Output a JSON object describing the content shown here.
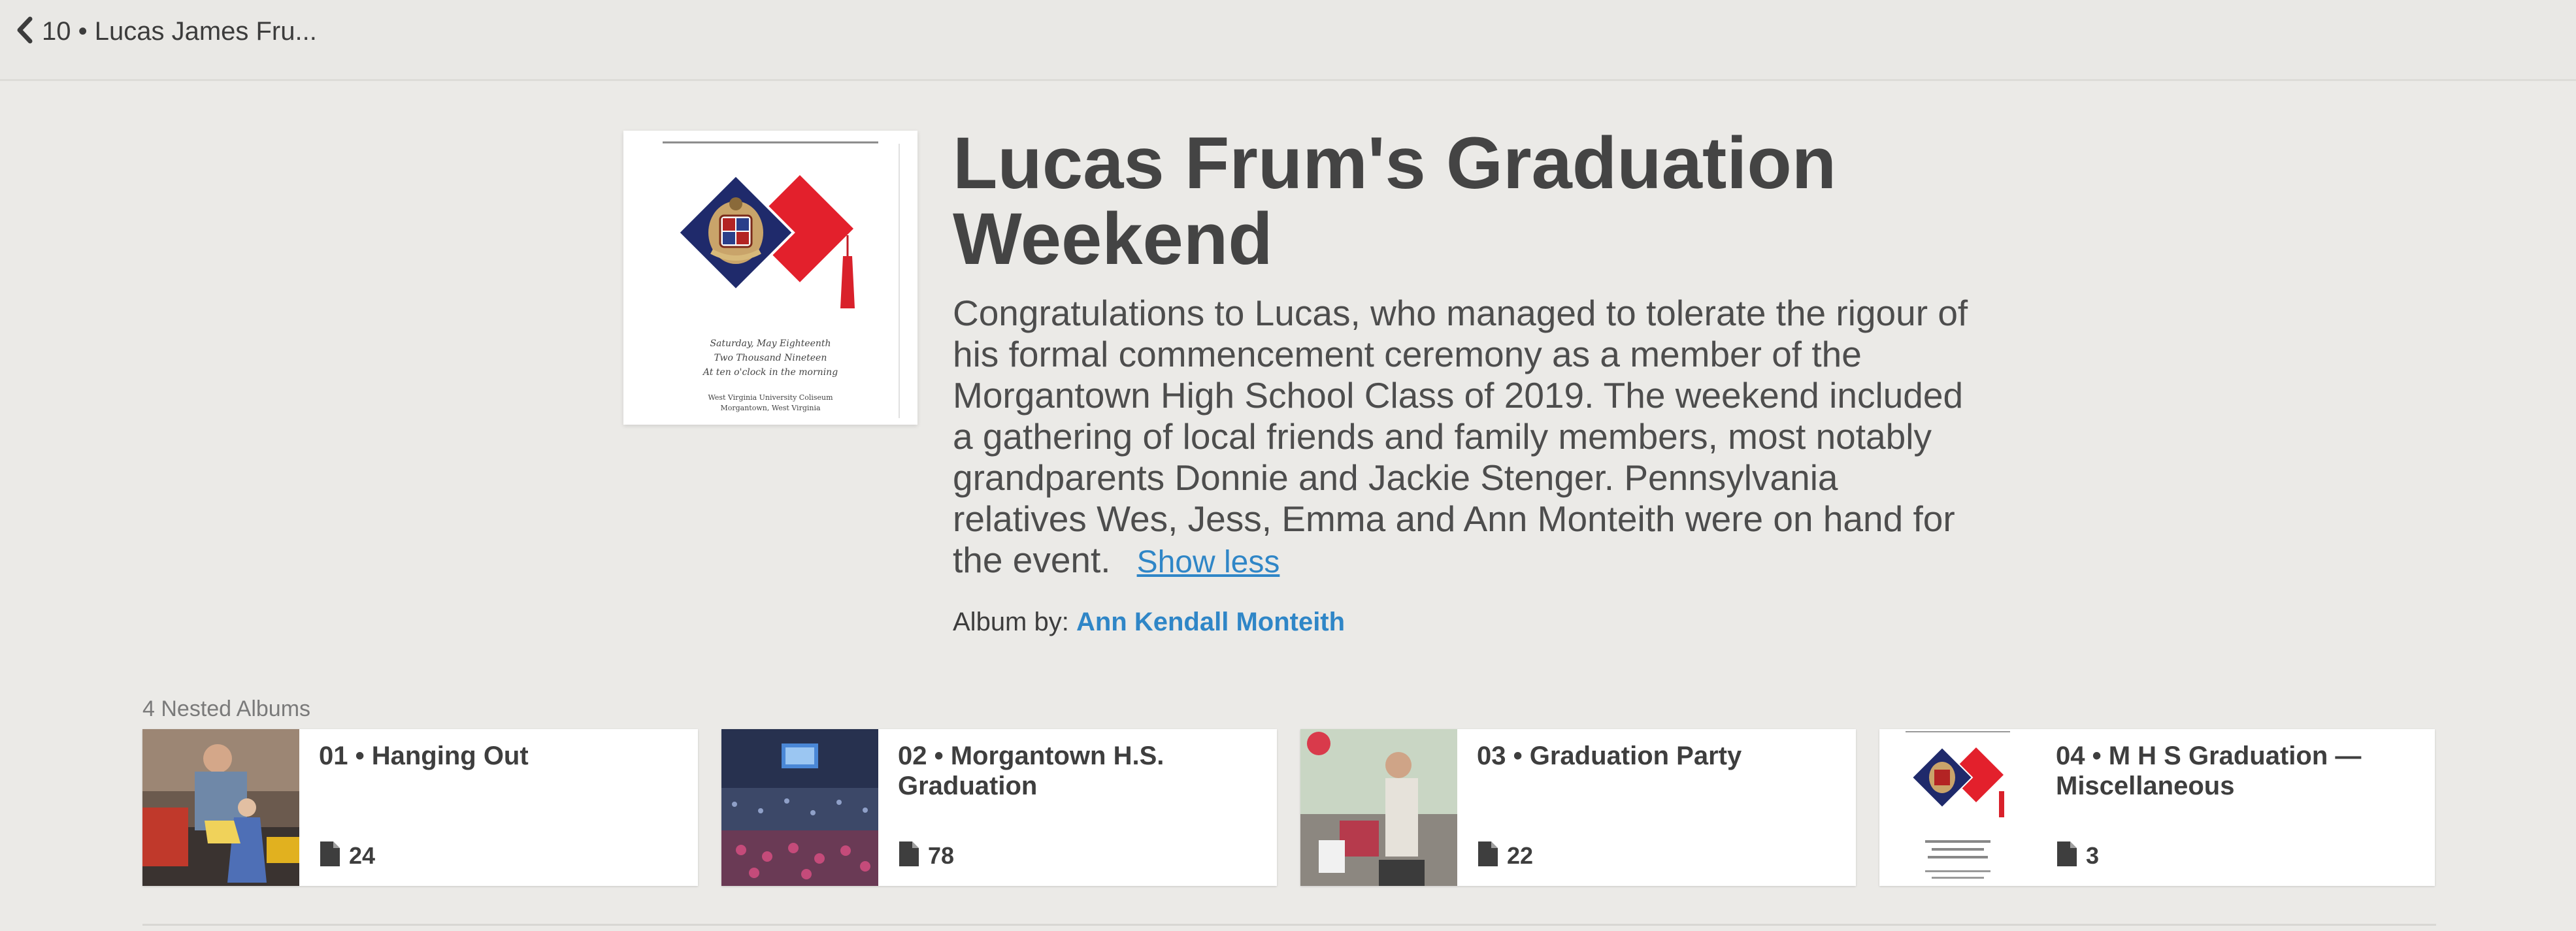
{
  "nav": {
    "back_label": "10 • Lucas James Fru..."
  },
  "album": {
    "title": "Lucas Frum's Graduation Weekend",
    "description": "Congratulations to Lucas, who managed to tolerate the rigour of his formal commencement ceremony as a member of the Morgantown High School Class of 2019. The weekend included a gathering of local friends and family members, most notably grandparents Donnie and Jackie Stenger. Pennsylvania relatives Wes, Jess, Emma and Ann Monteith were on hand for the event.",
    "show_less_label": "Show less",
    "byline_prefix": "Album by:",
    "author": "Ann Kendall Monteith"
  },
  "cover_invite": {
    "date_lines": [
      "Saturday, May Eighteenth",
      "Two Thousand Nineteen",
      "At ten o'clock in the morning"
    ],
    "venue_lines": [
      "West Virginia University Coliseum",
      "Morgantown, West Virginia"
    ]
  },
  "nested": {
    "label": "4 Nested Albums",
    "albums": [
      {
        "title": "01 • Hanging Out",
        "count": "24",
        "icon": "file-icon"
      },
      {
        "title": "02 • Morgantown H.S. Graduation",
        "count": "78",
        "icon": "file-icon"
      },
      {
        "title": "03 • Graduation Party",
        "count": "22",
        "icon": "file-icon"
      },
      {
        "title": "04 • M H S Graduation — Miscellaneous",
        "count": "3",
        "icon": "file-icon"
      }
    ]
  },
  "colors": {
    "background": "#ebeae7",
    "link": "#2f86c7",
    "navy": "#1f2a6b",
    "red": "#e3202c"
  }
}
